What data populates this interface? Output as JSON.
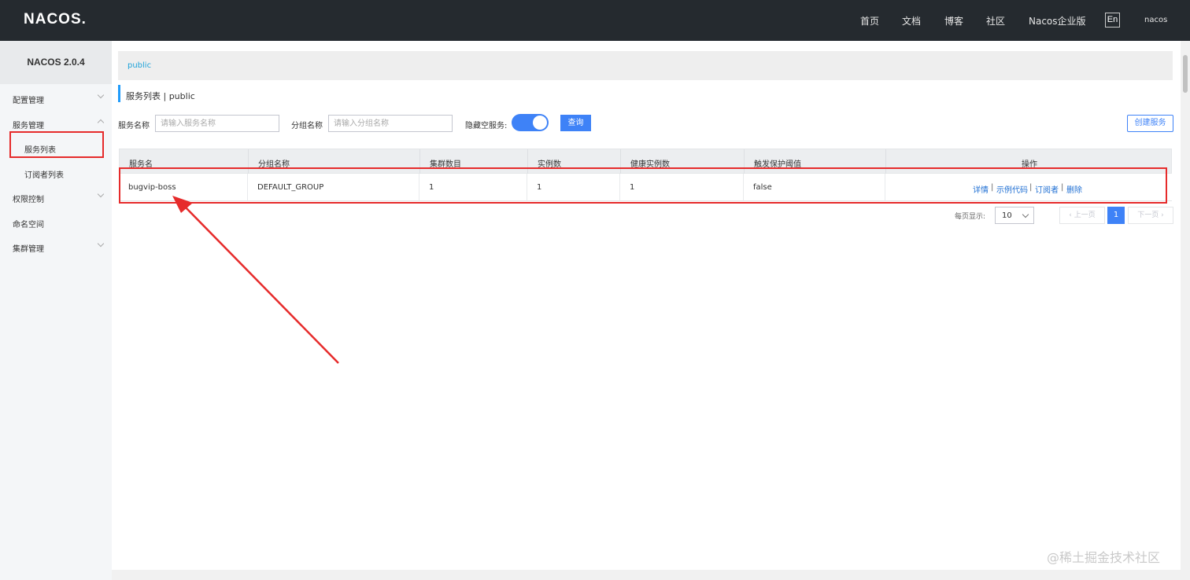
{
  "header": {
    "logo": "NACOS.",
    "nav": [
      "首页",
      "文档",
      "博客",
      "社区",
      "Nacos企业版"
    ],
    "lang": "En",
    "user": "nacos"
  },
  "sidebar": {
    "version": "NACOS 2.0.4",
    "items": {
      "config": "配置管理",
      "service": "服务管理",
      "service_list": "服务列表",
      "subscriber_list": "订阅者列表",
      "auth": "权限控制",
      "namespace": "命名空间",
      "cluster": "集群管理"
    }
  },
  "main": {
    "namespace": "public",
    "title": "服务列表 | public",
    "filters": {
      "service_name_label": "服务名称",
      "service_name_placeholder": "请输入服务名称",
      "group_name_label": "分组名称",
      "group_name_placeholder": "请输入分组名称",
      "hide_empty_label": "隐藏空服务:",
      "query_label": "查询",
      "create_label": "创建服务"
    },
    "table": {
      "columns": [
        "服务名",
        "分组名称",
        "集群数目",
        "实例数",
        "健康实例数",
        "触发保护阈值",
        "操作"
      ],
      "rows": [
        {
          "service": "bugvip-boss",
          "group": "DEFAULT_GROUP",
          "clusters": "1",
          "instances": "1",
          "healthy": "1",
          "threshold": "false",
          "ops": [
            "详情",
            "示例代码",
            "订阅者",
            "删除"
          ]
        }
      ]
    },
    "pagination": {
      "page_size_label": "每页显示:",
      "page_size": "10",
      "prev": "上一页",
      "current": "1",
      "next": "下一页"
    }
  },
  "watermark": "@稀土掘金技术社区",
  "colors": {
    "topbar": "#252a2f",
    "primary": "#3e82f7",
    "highlight": "#e62b2b",
    "link": "#1f6fd3"
  }
}
